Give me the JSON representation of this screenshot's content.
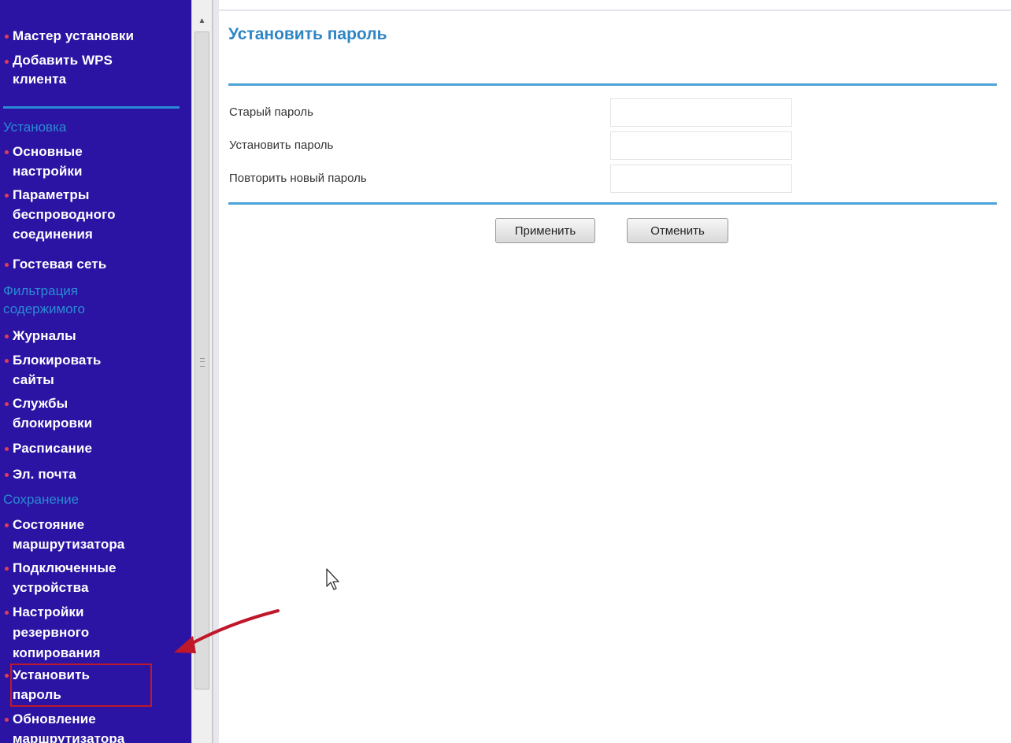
{
  "sidebar": {
    "items": [
      {
        "label": "Мастер установки"
      },
      {
        "label": "Добавить WPS\nклиента"
      },
      {
        "label": "Основные\nнастройки"
      },
      {
        "label": "Параметры\nбеспроводного\nсоединения"
      },
      {
        "label": "Гостевая сеть"
      },
      {
        "label": "Журналы"
      },
      {
        "label": "Блокировать\nсайты"
      },
      {
        "label": "Службы\nблокировки"
      },
      {
        "label": "Расписание"
      },
      {
        "label": "Эл. почта"
      },
      {
        "label": "Состояние\nмаршрутизатора"
      },
      {
        "label": "Подключенные\nустройства"
      },
      {
        "label": "Настройки\nрезервного\nкопирования"
      },
      {
        "label": "Установить\nпароль"
      },
      {
        "label": "Обновление\nмаршрутизатора"
      }
    ],
    "sections": [
      {
        "label": "Установка"
      },
      {
        "label": "Фильтрация\nсодержимого"
      },
      {
        "label": "Сохранение"
      }
    ],
    "highlighted_item": "Установить пароль"
  },
  "main": {
    "title": "Установить пароль",
    "fields": [
      {
        "label": "Старый пароль",
        "value": ""
      },
      {
        "label": "Установить пароль",
        "value": ""
      },
      {
        "label": "Повторить новый пароль",
        "value": ""
      }
    ],
    "buttons": {
      "apply": "Применить",
      "cancel": "Отменить"
    }
  },
  "colors": {
    "sidebar_bg": "#2b14a3",
    "sidebar_text": "#ffffff",
    "section_heading": "#2a8ad4",
    "bullet": "#e23b5a",
    "title": "#2e86c5",
    "divider": "#4aa3d6",
    "annotation": "#c0182a"
  },
  "icons": {
    "cursor": "mouse-pointer-icon",
    "annotation_arrow": "red-arrow-icon",
    "scroll_up": "scroll-up-arrow-icon"
  }
}
